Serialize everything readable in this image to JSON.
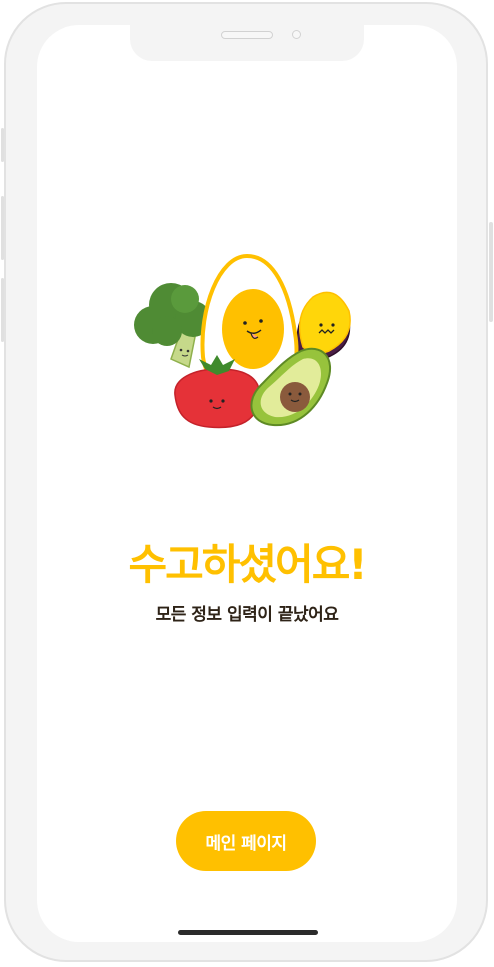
{
  "completion_screen": {
    "title": "수고하셨어요!",
    "subtitle": "모든 정보 입력이 끝났어요",
    "main_button_label": "메인 페이지"
  },
  "illustration": {
    "characters": [
      "broccoli",
      "egg",
      "sweet-potato",
      "tomato",
      "avocado"
    ]
  },
  "colors": {
    "accent": "#ffc000",
    "text_dark": "#2e2317",
    "button_text": "#ffffff",
    "background": "#ffffff"
  }
}
